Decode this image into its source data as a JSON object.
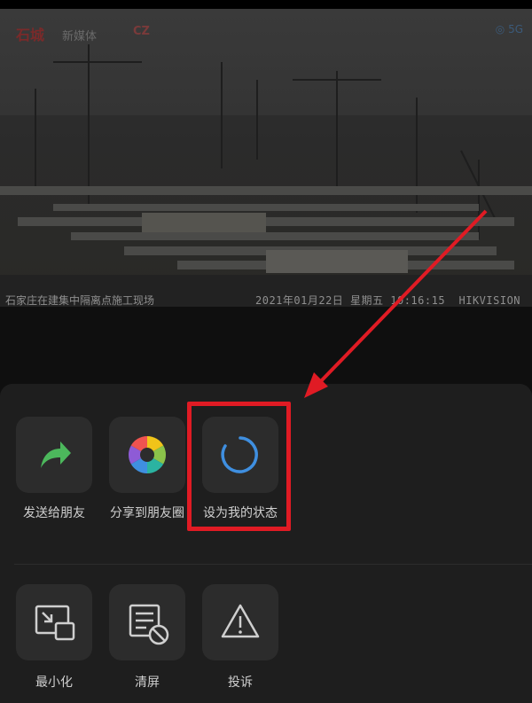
{
  "video": {
    "brand": "新媒体",
    "caption": "石家庄在建集中隔离点施工现场",
    "timestamp": "2021年01月22日 星期五 10:16:15",
    "watermark": "HIKVISION",
    "badge": "5G"
  },
  "share_row": [
    {
      "label": "发送给朋友",
      "icon": "share-forward-icon"
    },
    {
      "label": "分享到朋友圈",
      "icon": "moments-icon"
    },
    {
      "label": "设为我的状态",
      "icon": "status-ring-icon"
    }
  ],
  "action_row": [
    {
      "label": "最小化",
      "icon": "minimize-window-icon"
    },
    {
      "label": "清屏",
      "icon": "clear-screen-icon"
    },
    {
      "label": "投诉",
      "icon": "warning-icon"
    }
  ],
  "colors": {
    "highlight": "#e01b24",
    "share_green": "#4cb85c",
    "status_blue": "#3f8fe0"
  }
}
